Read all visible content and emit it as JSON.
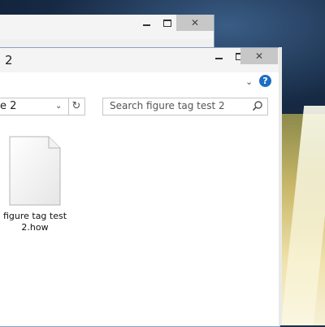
{
  "window": {
    "title": "2",
    "close_glyph": "✕"
  },
  "back_window": {
    "close_glyph": "✕"
  },
  "address_bar": {
    "path_text": "e 2",
    "dropdown_glyph": "⌄",
    "refresh_glyph": "↻"
  },
  "search": {
    "placeholder": "Search figure tag test 2"
  },
  "ribbon": {
    "expand_glyph": "⌄",
    "help_glyph": "?"
  },
  "files": [
    {
      "name_line1": "figure tag test",
      "name_line2": "2.how",
      "icon": "document-icon"
    }
  ],
  "colors": {
    "help_blue": "#1b6ec2",
    "close_button": "#c7c7c7",
    "border": "#8aa2c0"
  }
}
